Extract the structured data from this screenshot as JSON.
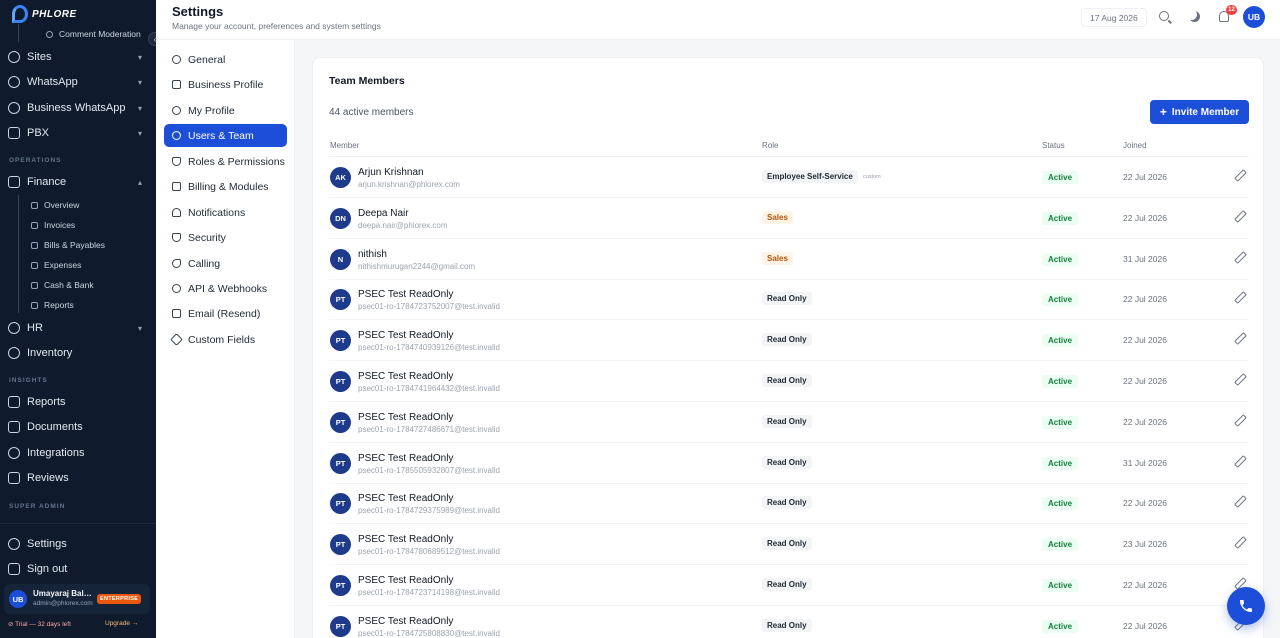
{
  "brand": {
    "logo_text": "PHLORE"
  },
  "sidebar": {
    "top_sub_item": "Comment Moderation",
    "collapse_glyph": "‹",
    "sections": {
      "operations": "OPERATIONS",
      "insights": "INSIGHTS",
      "super_admin": "SUPER ADMIN"
    },
    "items": {
      "sites": "Sites",
      "whatsapp": "WhatsApp",
      "business_whatsapp": "Business WhatsApp",
      "pbx": "PBX",
      "finance": "Finance",
      "hr": "HR",
      "inventory": "Inventory",
      "reports": "Reports",
      "documents": "Documents",
      "integrations": "Integrations",
      "reviews": "Reviews",
      "settings": "Settings",
      "sign_out": "Sign out"
    },
    "finance_sub": [
      "Overview",
      "Invoices",
      "Bills & Payables",
      "Expenses",
      "Cash & Bank",
      "Reports"
    ],
    "user": {
      "initials": "UB",
      "name": "Umayaraj Balakrishnan",
      "email": "admin@phlorex.com",
      "plan": "ENTERPRISE"
    },
    "trial_text": "⊘ Trial — 32 days left",
    "upgrade_link": "Upgrade →"
  },
  "header": {
    "title": "Settings",
    "subtitle": "Manage your account, preferences and system settings",
    "date": "17 Aug 2026",
    "notification_count": "12",
    "avatar_initials": "UB"
  },
  "settings_menu": [
    {
      "label": "General",
      "icon": "globe-icon"
    },
    {
      "label": "Business Profile",
      "icon": "building-icon"
    },
    {
      "label": "My Profile",
      "icon": "user-icon"
    },
    {
      "label": "Users & Team",
      "icon": "users-icon",
      "active": true
    },
    {
      "label": "Roles & Permissions",
      "icon": "shield-icon"
    },
    {
      "label": "Billing & Modules",
      "icon": "card-icon"
    },
    {
      "label": "Notifications",
      "icon": "bell-icon"
    },
    {
      "label": "Security",
      "icon": "shield-icon"
    },
    {
      "label": "Calling",
      "icon": "phone-icon"
    },
    {
      "label": "API & Webhooks",
      "icon": "webhook-icon"
    },
    {
      "label": "Email (Resend)",
      "icon": "mail-icon"
    },
    {
      "label": "Custom Fields",
      "icon": "layers-icon"
    }
  ],
  "team": {
    "title": "Team Members",
    "subtitle": "44 active members",
    "invite_label": "Invite Member",
    "columns": {
      "member": "Member",
      "role": "Role",
      "status": "Status",
      "joined": "Joined"
    },
    "custom_tag": "custom",
    "rows": [
      {
        "initials": "AK",
        "name": "Arjun Krishnan",
        "email": "arjun.krishnan@phlorex.com",
        "role": "Employee Self-Service",
        "role_style": "neutral",
        "custom": true,
        "status": "Active",
        "joined": "22 Jul 2026"
      },
      {
        "initials": "DN",
        "name": "Deepa Nair",
        "email": "deepa.nair@phlorex.com",
        "role": "Sales",
        "role_style": "sales",
        "status": "Active",
        "joined": "22 Jul 2026"
      },
      {
        "initials": "N",
        "name": "nithish",
        "email": "nithishmurugan2244@gmail.com",
        "role": "Sales",
        "role_style": "sales",
        "status": "Active",
        "joined": "31 Jul 2026"
      },
      {
        "initials": "PT",
        "name": "PSEC Test ReadOnly",
        "email": "psec01-ro-1784723752007@test.invalid",
        "role": "Read Only",
        "role_style": "neutral",
        "status": "Active",
        "joined": "22 Jul 2026"
      },
      {
        "initials": "PT",
        "name": "PSEC Test ReadOnly",
        "email": "psec01-ro-1784740939126@test.invalid",
        "role": "Read Only",
        "role_style": "neutral",
        "status": "Active",
        "joined": "22 Jul 2026"
      },
      {
        "initials": "PT",
        "name": "PSEC Test ReadOnly",
        "email": "psec01-ro-1784741964432@test.invalid",
        "role": "Read Only",
        "role_style": "neutral",
        "status": "Active",
        "joined": "22 Jul 2026"
      },
      {
        "initials": "PT",
        "name": "PSEC Test ReadOnly",
        "email": "psec01-ro-1784727486671@test.invalid",
        "role": "Read Only",
        "role_style": "neutral",
        "status": "Active",
        "joined": "22 Jul 2026"
      },
      {
        "initials": "PT",
        "name": "PSEC Test ReadOnly",
        "email": "psec01-ro-1785505932807@test.invalid",
        "role": "Read Only",
        "role_style": "neutral",
        "status": "Active",
        "joined": "31 Jul 2026"
      },
      {
        "initials": "PT",
        "name": "PSEC Test ReadOnly",
        "email": "psec01-ro-1784729375989@test.invalid",
        "role": "Read Only",
        "role_style": "neutral",
        "status": "Active",
        "joined": "22 Jul 2026"
      },
      {
        "initials": "PT",
        "name": "PSEC Test ReadOnly",
        "email": "psec01-ro-1784780689512@test.invalid",
        "role": "Read Only",
        "role_style": "neutral",
        "status": "Active",
        "joined": "23 Jul 2026"
      },
      {
        "initials": "PT",
        "name": "PSEC Test ReadOnly",
        "email": "psec01-ro-1784723714198@test.invalid",
        "role": "Read Only",
        "role_style": "neutral",
        "status": "Active",
        "joined": "22 Jul 2026"
      },
      {
        "initials": "PT",
        "name": "PSEC Test ReadOnly",
        "email": "psec01-ro-1784725808830@test.invalid",
        "role": "Read Only",
        "role_style": "neutral",
        "status": "Active",
        "joined": "22 Jul 2026"
      }
    ]
  },
  "colors": {
    "primary": "#1d4ed8",
    "sidebar_bg": "#0f1b2d",
    "active_green": "#15803d",
    "sales_orange": "#b45309",
    "badge_red": "#ef4444"
  },
  "icons": {
    "call_fab": "phone-icon",
    "search": "search-icon",
    "theme": "moon-icon",
    "notifications": "bell-icon",
    "edit": "pencil-icon"
  }
}
